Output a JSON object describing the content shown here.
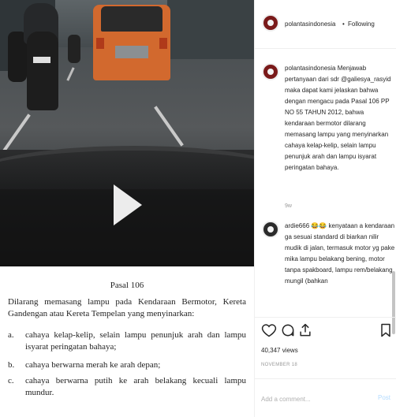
{
  "header": {
    "username": "polantasindonesia",
    "separator": "•",
    "follow_label": "Following"
  },
  "comments": [
    {
      "text": "polantasindonesia Menjawab pertanyaan dari sdr @galiesya_rasyid maka dapat kami jelaskan bahwa dengan mengacu pada Pasal 106 PP NO 55 TAHUN 2012, bahwa kendaraan bermotor dilarang memasang lampu yang menyinarkan cahaya kelap-kelip, selain lampu penunjuk arah dan lampu isyarat peringatan bahaya.",
      "time": "9w"
    },
    {
      "text": "ardie666 😂😂 kenyataan a kendaraan ga sesuai standard di biarkan nilir mudik di jalan, termasuk motor yg pake mika lampu belakang bening, motor tanpa spakboard, lampu rem/belakang mungil (bahkan"
    }
  ],
  "actions": {
    "like_icon": "heart-icon",
    "comment_icon": "comment-icon",
    "share_icon": "share-icon",
    "save_icon": "bookmark-icon"
  },
  "views": "40,347 views",
  "date": "NOVEMBER 18",
  "add_comment": {
    "placeholder": "Add a comment...",
    "post_label": "Post"
  },
  "video": {
    "play_icon": "play-icon"
  },
  "document": {
    "title": "Pasal 106",
    "paragraph": "Dilarang memasang lampu pada Kendaraan Bermotor, Kereta Gandengan atau Kereta Tempelan yang menyinarkan:",
    "items": [
      {
        "label": "a.",
        "text": "cahaya kelap-kelip, selain lampu penunjuk arah dan lampu isyarat peringatan bahaya;"
      },
      {
        "label": "b.",
        "text": "cahaya berwarna merah ke arah depan;"
      },
      {
        "label": "c.",
        "text": "cahaya berwarna putih ke arah belakang kecuali lampu mundur."
      }
    ]
  },
  "colors": {
    "post_disabled": "#b3dbff",
    "text": "#262626",
    "muted": "#999999"
  }
}
